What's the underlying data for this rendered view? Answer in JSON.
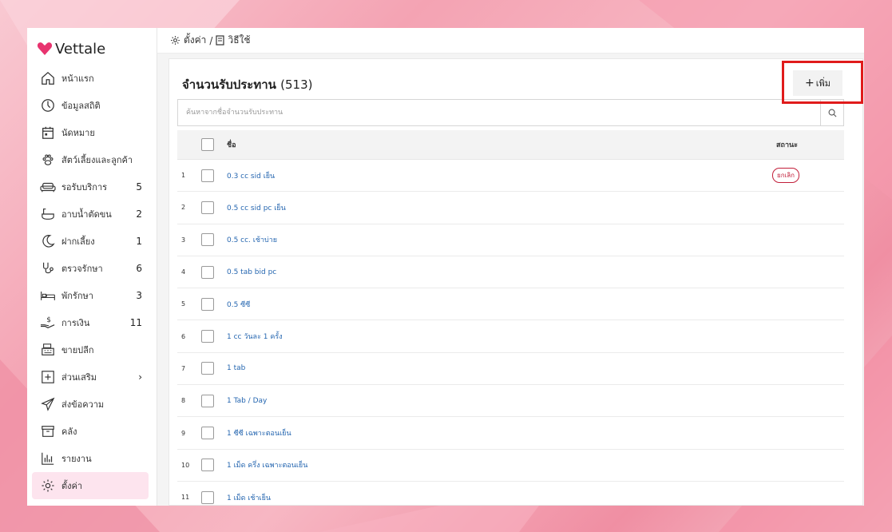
{
  "brand": {
    "name": "Vettale",
    "accent": "#e8336f"
  },
  "breadcrumb": {
    "settings": "ตั้งค่า",
    "separator": "/",
    "page": "วิธีใช้"
  },
  "sidebar": {
    "items": [
      {
        "label": "หน้าแรก",
        "icon": "home-icon",
        "count": ""
      },
      {
        "label": "ข้อมูลสถิติ",
        "icon": "dashboard-icon",
        "count": ""
      },
      {
        "label": "นัดหมาย",
        "icon": "calendar-icon",
        "count": ""
      },
      {
        "label": "สัตว์เลี้ยงและลูกค้า",
        "icon": "paw-icon",
        "count": ""
      },
      {
        "label": "รอรับบริการ",
        "icon": "sofa-icon",
        "count": "5"
      },
      {
        "label": "อาบน้ำตัดขน",
        "icon": "bathtub-icon",
        "count": "2"
      },
      {
        "label": "ฝากเลี้ยง",
        "icon": "moon-icon",
        "count": "1"
      },
      {
        "label": "ตรวจรักษา",
        "icon": "stethoscope-icon",
        "count": "6"
      },
      {
        "label": "พักรักษา",
        "icon": "bed-icon",
        "count": "3"
      },
      {
        "label": "การเงิน",
        "icon": "money-hand-icon",
        "count": "11"
      },
      {
        "label": "ขายปลีก",
        "icon": "cash-register-icon",
        "count": ""
      },
      {
        "label": "ส่วนเสริม",
        "icon": "plus-square-icon",
        "count": "›"
      },
      {
        "label": "ส่งข้อความ",
        "icon": "send-icon",
        "count": ""
      },
      {
        "label": "คลัง",
        "icon": "archive-icon",
        "count": ""
      },
      {
        "label": "รายงาน",
        "icon": "bar-chart-icon",
        "count": ""
      },
      {
        "label": "ตั้งค่า",
        "icon": "gear-icon",
        "count": ""
      }
    ]
  },
  "main": {
    "title": "จำนวนรับประทาน",
    "count": "(513)",
    "add_label": "เพิ่ม",
    "search_placeholder": "ค้นหาจากชื่อจำนวนรับประทาน",
    "columns": {
      "name": "ชื่อ",
      "status": "สถานะ"
    },
    "rows": [
      {
        "idx": "1",
        "name": "0.3 cc sid เย็น",
        "status": "ยกเลิก"
      },
      {
        "idx": "2",
        "name": "0.5 cc sid pc เย็น",
        "status": ""
      },
      {
        "idx": "3",
        "name": "0.5 cc. เช้าบ่าย",
        "status": ""
      },
      {
        "idx": "4",
        "name": "0.5 tab bid pc",
        "status": ""
      },
      {
        "idx": "5",
        "name": "0.5 ซีซี",
        "status": ""
      },
      {
        "idx": "6",
        "name": "1 cc วันละ 1 ครั้ง",
        "status": ""
      },
      {
        "idx": "7",
        "name": "1 tab",
        "status": ""
      },
      {
        "idx": "8",
        "name": "1 Tab / Day",
        "status": ""
      },
      {
        "idx": "9",
        "name": "1 ซีซี เฉพาะตอนเย็น",
        "status": ""
      },
      {
        "idx": "10",
        "name": "1 เม็ด ครึ่ง เฉพาะตอนเย็น",
        "status": ""
      },
      {
        "idx": "11",
        "name": "1 เม็ด เช้าเย็น",
        "status": ""
      }
    ]
  },
  "colors": {
    "link": "#2566b0",
    "cancel_badge": "#c21f3a",
    "highlight": "#e01b1b",
    "active_nav": "#fde4ee"
  }
}
